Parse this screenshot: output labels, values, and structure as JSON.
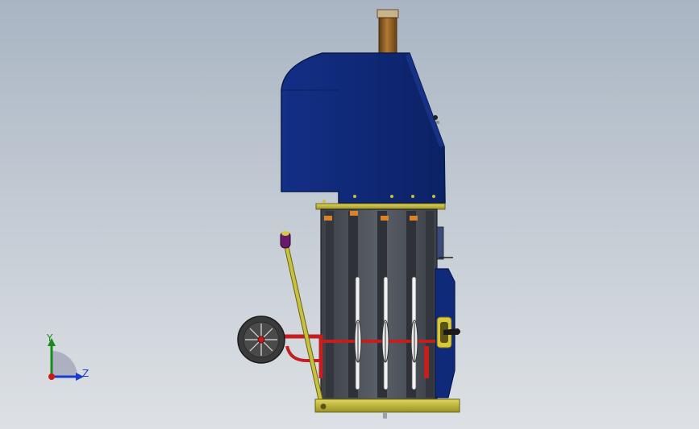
{
  "viewport": {
    "background_top": "#a9b5c3",
    "background_bottom": "#dde1e5"
  },
  "model": {
    "colors": {
      "cover": "#102a7a",
      "cover_shade": "#0b1f60",
      "chimney": "#8a5a22",
      "frame": "#4a4f56",
      "base_plate": "#c9c040",
      "pipe": "#c41e1e",
      "handle": "#c9c040",
      "grip": "#6a1a6a",
      "wheel": "#3a3a3a"
    }
  },
  "triad": {
    "y_label": "Y",
    "z_label": "Z",
    "y_color": "#1a8a1a",
    "z_color": "#1a3acc",
    "origin_color": "#cc1a1a"
  }
}
